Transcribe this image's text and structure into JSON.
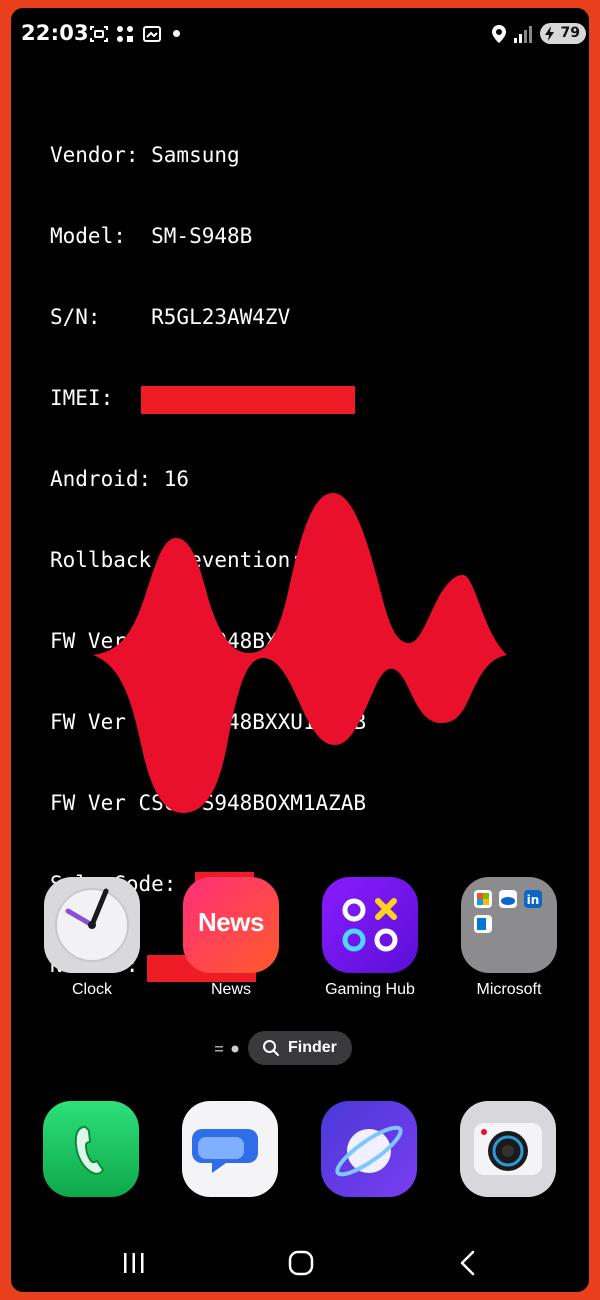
{
  "status_bar": {
    "time": "22:03",
    "battery": "79"
  },
  "device_info": {
    "vendor": "Vendor: Samsung",
    "model": "Model:  SM-S948B",
    "serial": "S/N:    R5GL23AW4ZV",
    "imei": "IMEI:",
    "android": "Android: 16",
    "rollback": "Rollback Prevention: 1",
    "fw_ap": "FW Ver AP:  S948BXXU1AZAB",
    "fw_cp": "FW Ver CP:  S948BXXU1AZAB",
    "fw_csc": "FW Ver CSC: S948BOXM1AZAB",
    "sales_code": "SalesCode:",
    "nemo_id": "NemoID:"
  },
  "apps": [
    {
      "label": "Clock",
      "icon": "clock-icon"
    },
    {
      "label": "News",
      "icon": "news-icon",
      "icon_text": "News"
    },
    {
      "label": "Gaming Hub",
      "icon": "gaming-hub-icon"
    },
    {
      "label": "Microsoft",
      "icon": "microsoft-folder-icon"
    }
  ],
  "finder": {
    "label": "Finder"
  },
  "dock": [
    {
      "icon": "phone-icon"
    },
    {
      "icon": "messages-icon"
    },
    {
      "icon": "internet-icon"
    },
    {
      "icon": "camera-icon"
    }
  ],
  "colors": {
    "frame": "#e8401c",
    "redaction": "#ee1c25",
    "wave": "#e8102a"
  }
}
